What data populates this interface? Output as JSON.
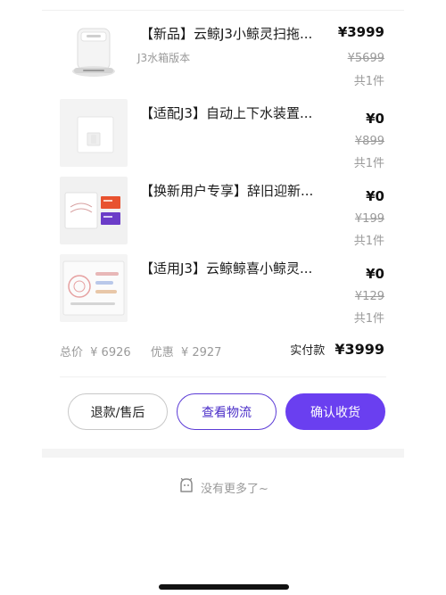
{
  "items": [
    {
      "title": "【新品】云鲸J3小鲸灵扫拖...",
      "variant": "J3水箱版本",
      "price": "¥3999",
      "original_price": "¥5699",
      "quantity": "共1件",
      "image_icon": "robot-vacuum-base-icon"
    },
    {
      "title": "【适配J3】自动上下水装置...",
      "variant": "",
      "price": "¥0",
      "original_price": "¥899",
      "quantity": "共1件",
      "image_icon": "water-module-icon"
    },
    {
      "title": "【换新用户专享】辞旧迎新...",
      "variant": "",
      "price": "¥0",
      "original_price": "¥199",
      "quantity": "共1件",
      "image_icon": "voucher-pack-icon"
    },
    {
      "title": "【适用J3】云鲸鲸喜小鲸灵...",
      "variant": "",
      "price": "¥0",
      "original_price": "¥129",
      "quantity": "共1件",
      "image_icon": "sticker-sheet-icon"
    }
  ],
  "summary": {
    "total_label": "总价",
    "total_value": "¥ 6926",
    "discount_label": "优惠",
    "discount_value": "¥ 2927",
    "paid_label": "实付款",
    "paid_value": "¥3999"
  },
  "actions": {
    "refund": "退款/售后",
    "logistics": "查看物流",
    "confirm": "确认收货"
  },
  "footer": {
    "no_more": "没有更多了~",
    "icon": "ghost-face-icon"
  },
  "colors": {
    "accent": "#6a3ff0",
    "accent_text": "#4b2fc8",
    "muted_text": "#9a9a9a"
  }
}
